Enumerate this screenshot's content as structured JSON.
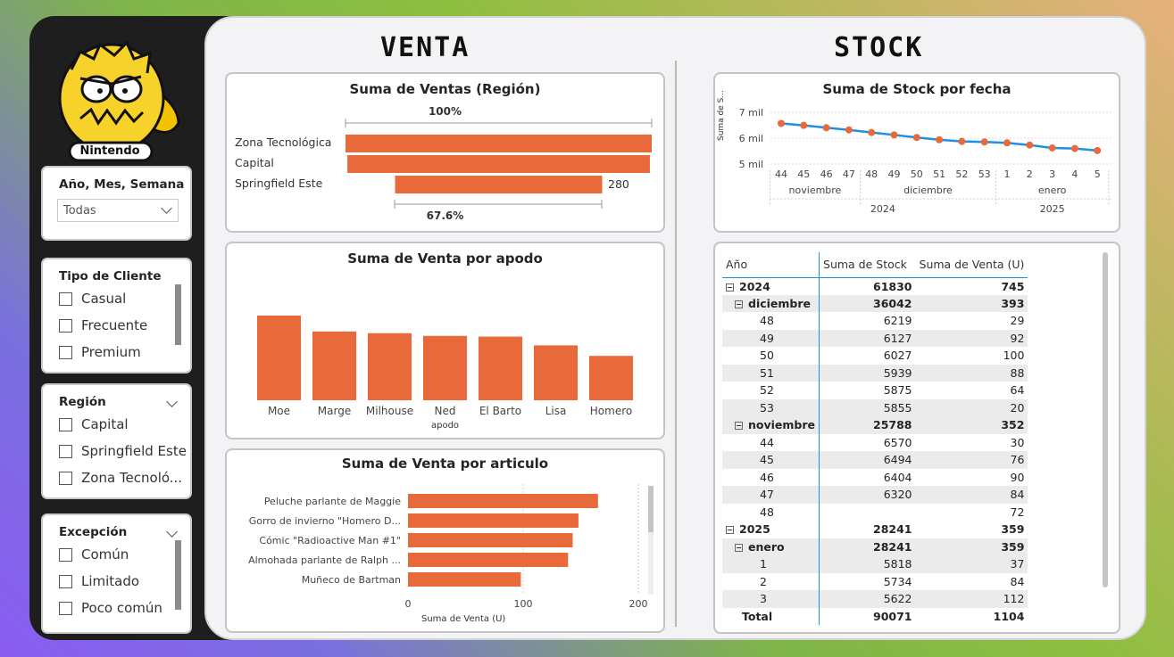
{
  "brand": {
    "logo_text": "Nintendo"
  },
  "filters": {
    "date": {
      "title": "Año, Mes, Semana",
      "value": "Todas"
    },
    "client_type": {
      "title": "Tipo de Cliente",
      "options": [
        "Casual",
        "Frecuente",
        "Premium"
      ]
    },
    "region": {
      "title": "Región",
      "options": [
        "Capital",
        "Springfield Este",
        "Zona Tecnoló..."
      ]
    },
    "exception": {
      "title": "Excepción",
      "options": [
        "Común",
        "Limitado",
        "Poco común"
      ]
    }
  },
  "sections": {
    "venta": "VENTA",
    "stock": "STOCK"
  },
  "colors": {
    "bar": "#e8693a",
    "line": "#1f8fe6",
    "point": "#e8693a"
  },
  "funnel": {
    "title": "Suma de Ventas (Región)",
    "top_pct": "100%",
    "bottom_pct": "67.6%",
    "categories": [
      "Zona Tecnológica",
      "Capital",
      "Springfield Este"
    ],
    "values": [
      414,
      409,
      280
    ],
    "value_label": "280"
  },
  "chart_data": [
    {
      "type": "bar",
      "title": "Suma de Venta por apodo",
      "xlabel": "apodo",
      "categories": [
        "Moe",
        "Marge",
        "Milhouse",
        "Ned",
        "El Barto",
        "Lisa",
        "Homero"
      ],
      "values": [
        250,
        203,
        198,
        190,
        188,
        162,
        131
      ]
    },
    {
      "type": "bar",
      "orientation": "horizontal",
      "title": "Suma de Venta por articulo",
      "xlabel": "Suma de Venta (U)",
      "categories": [
        "Peluche parlante de Maggie",
        "Gorro de invierno \"Homero D...",
        "Cómic \"Radioactive Man #1\"",
        "Almohada parlante de Ralph ...",
        "Muñeco de Bartman"
      ],
      "values": [
        165,
        148,
        143,
        139,
        98
      ],
      "xticks": [
        "0",
        "100",
        "200"
      ],
      "xlim": [
        0,
        200
      ]
    },
    {
      "type": "line",
      "title": "Suma de Stock por fecha",
      "ylabel": "Suma de S...",
      "x": [
        "44",
        "45",
        "46",
        "47",
        "48",
        "49",
        "50",
        "51",
        "52",
        "53",
        "1",
        "2",
        "3",
        "4",
        "5"
      ],
      "values": [
        6570,
        6494,
        6404,
        6320,
        6219,
        6127,
        6027,
        5939,
        5875,
        5855,
        5818,
        5734,
        5622,
        5600,
        5520
      ],
      "yticks": [
        "7 mil",
        "6 mil",
        "5 mil"
      ],
      "ylim": [
        5000,
        7000
      ],
      "months": [
        "noviembre",
        "diciembre",
        "enero"
      ],
      "years": [
        "2024",
        "2025"
      ]
    }
  ],
  "matrix": {
    "headers": [
      "Año",
      "Suma de Stock",
      "Suma de Venta (U)"
    ],
    "rows": [
      {
        "label": "2024",
        "stock": "61830",
        "venta": "745",
        "level": 0,
        "bold": true,
        "toggle": "⊟"
      },
      {
        "label": "diciembre",
        "stock": "36042",
        "venta": "393",
        "level": 1,
        "bold": true,
        "toggle": "⊟"
      },
      {
        "label": "48",
        "stock": "6219",
        "venta": "29",
        "level": 2
      },
      {
        "label": "49",
        "stock": "6127",
        "venta": "92",
        "level": 2
      },
      {
        "label": "50",
        "stock": "6027",
        "venta": "100",
        "level": 2
      },
      {
        "label": "51",
        "stock": "5939",
        "venta": "88",
        "level": 2
      },
      {
        "label": "52",
        "stock": "5875",
        "venta": "64",
        "level": 2
      },
      {
        "label": "53",
        "stock": "5855",
        "venta": "20",
        "level": 2
      },
      {
        "label": "noviembre",
        "stock": "25788",
        "venta": "352",
        "level": 1,
        "bold": true,
        "toggle": "⊟"
      },
      {
        "label": "44",
        "stock": "6570",
        "venta": "30",
        "level": 2
      },
      {
        "label": "45",
        "stock": "6494",
        "venta": "76",
        "level": 2
      },
      {
        "label": "46",
        "stock": "6404",
        "venta": "90",
        "level": 2
      },
      {
        "label": "47",
        "stock": "6320",
        "venta": "84",
        "level": 2
      },
      {
        "label": "48",
        "stock": "",
        "venta": "72",
        "level": 2
      },
      {
        "label": "2025",
        "stock": "28241",
        "venta": "359",
        "level": 0,
        "bold": true,
        "toggle": "⊟"
      },
      {
        "label": "enero",
        "stock": "28241",
        "venta": "359",
        "level": 1,
        "bold": true,
        "toggle": "⊟"
      },
      {
        "label": "1",
        "stock": "5818",
        "venta": "37",
        "level": 2
      },
      {
        "label": "2",
        "stock": "5734",
        "venta": "84",
        "level": 2
      },
      {
        "label": "3",
        "stock": "5622",
        "venta": "112",
        "level": 2
      }
    ],
    "total": {
      "label": "Total",
      "stock": "90071",
      "venta": "1104"
    }
  }
}
